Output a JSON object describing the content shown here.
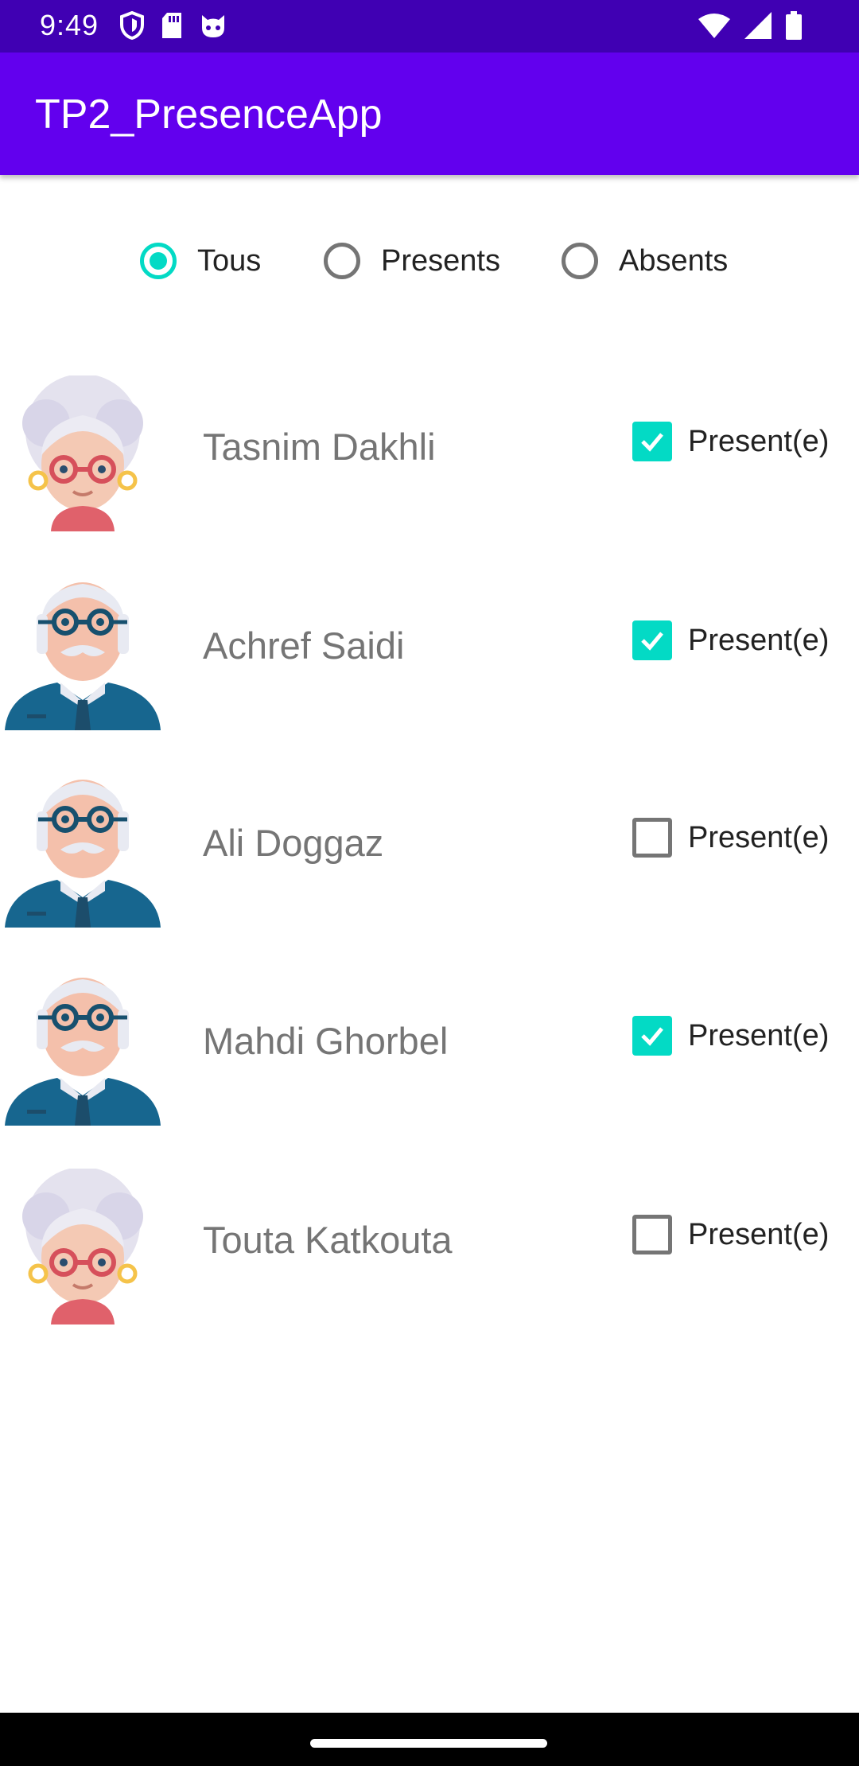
{
  "status_bar": {
    "time": "9:49",
    "left_icons": [
      "shield-icon",
      "sd-card-icon",
      "cat-face-icon"
    ],
    "right_icons": [
      "wifi-icon",
      "signal-icon",
      "battery-icon"
    ]
  },
  "app_bar": {
    "title": "TP2_PresenceApp"
  },
  "filter": {
    "options": [
      {
        "label": "Tous",
        "selected": true
      },
      {
        "label": "Presents",
        "selected": false
      },
      {
        "label": "Absents",
        "selected": false
      }
    ]
  },
  "students": [
    {
      "name": "Tasnim Dakhli",
      "avatar": "grandmother-avatar",
      "present_label": "Present(e)",
      "present": true
    },
    {
      "name": "Achref Saidi",
      "avatar": "grandfather-avatar",
      "present_label": "Present(e)",
      "present": true
    },
    {
      "name": "Ali Doggaz",
      "avatar": "grandfather-avatar",
      "present_label": "Present(e)",
      "present": false
    },
    {
      "name": "Mahdi Ghorbel",
      "avatar": "grandfather-avatar",
      "present_label": "Present(e)",
      "present": true
    },
    {
      "name": "Touta Katkouta",
      "avatar": "grandmother-avatar",
      "present_label": "Present(e)",
      "present": false
    }
  ],
  "colors": {
    "status_bar": "#4000b3",
    "app_bar": "#6200ee",
    "accent": "#03dac5",
    "name_text": "#757575"
  }
}
